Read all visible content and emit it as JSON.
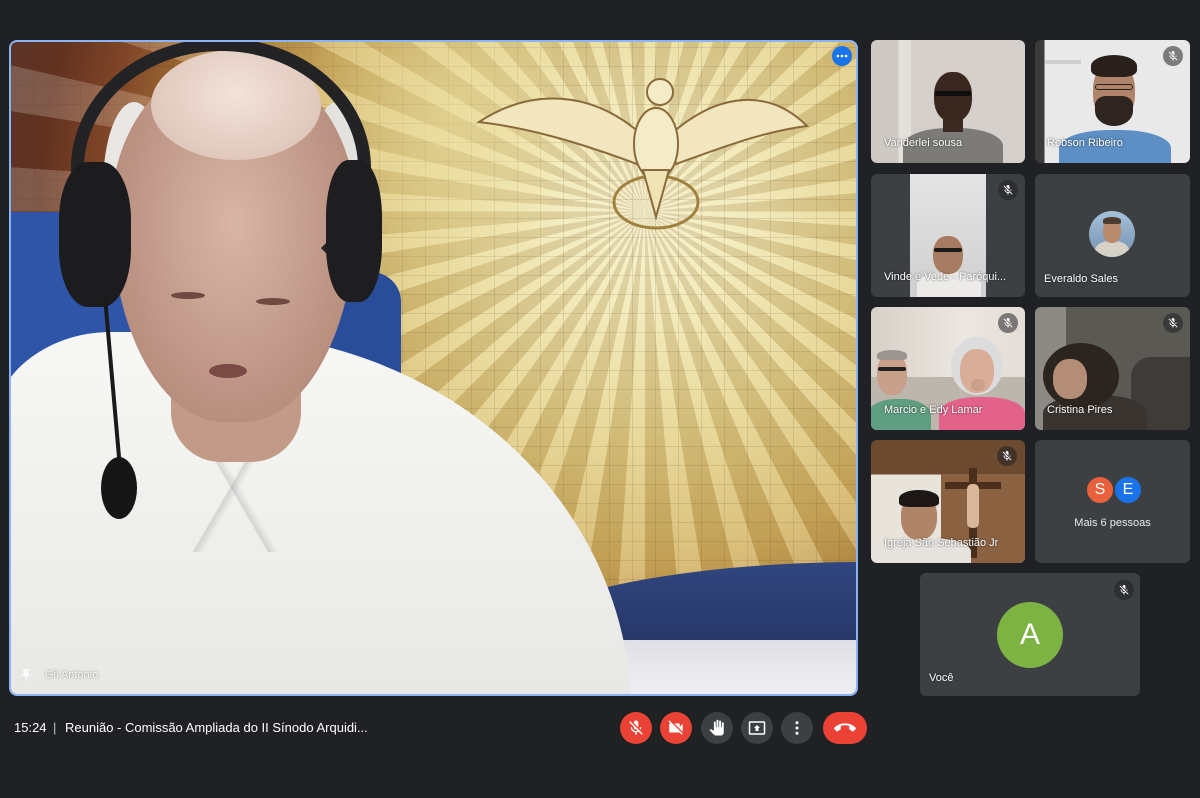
{
  "meeting": {
    "time": "15:24",
    "separator": "|",
    "title": "Reunião - Comissão Ampliada do II Sínodo Arquidi..."
  },
  "main_video": {
    "name": "Gil Antonio",
    "label_icon": "pin-icon",
    "options_icon": "more-horiz-icon",
    "active_speaker": true
  },
  "tiles": [
    {
      "name": "Vanderlei sousa",
      "muted": false
    },
    {
      "name": "Robson Ribeiro",
      "muted": true
    },
    {
      "name": "Vinde e Vede - Paróqui...",
      "muted": true
    },
    {
      "name": "Everaldo Sales",
      "muted": false,
      "camera_on": false
    },
    {
      "name": "Marcio e Edy Lamar",
      "muted": true
    },
    {
      "name": "Cristina Pires",
      "muted": true
    },
    {
      "name": "Igreja São Sebastião Jr",
      "muted": true
    }
  ],
  "more_tile": {
    "label": "Mais 6 pessoas",
    "avatars": [
      {
        "letter": "S",
        "color": "#E8603C"
      },
      {
        "letter": "E",
        "color": "#1A73E8"
      }
    ]
  },
  "self_tile": {
    "name": "Você",
    "avatar_letter": "A",
    "avatar_color": "#7CB342",
    "muted": true
  },
  "controls": [
    {
      "icon": "mic-off-icon",
      "enabled": false,
      "color": "#EA4335"
    },
    {
      "icon": "videocam-off-icon",
      "enabled": false,
      "color": "#EA4335"
    },
    {
      "icon": "raise-hand-icon",
      "color": "#3C4043"
    },
    {
      "icon": "present-icon",
      "color": "#3C4043"
    },
    {
      "icon": "more-vert-icon",
      "color": "#3C4043"
    },
    {
      "icon": "call-end-icon",
      "color": "#EA4335"
    }
  ],
  "theme": {
    "background": "#202124",
    "tile": "#3C4043",
    "active_border": "#8AB4F8",
    "accent": "#1A73E8"
  }
}
